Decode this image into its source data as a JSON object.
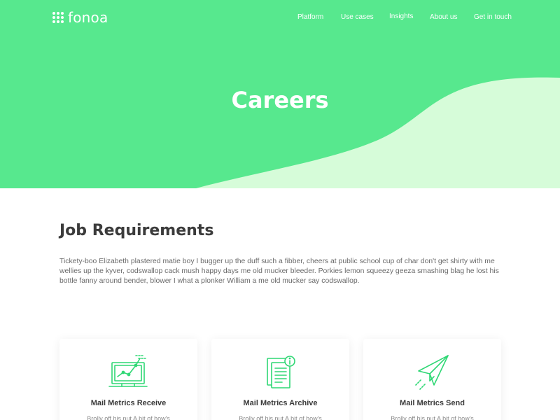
{
  "brand": {
    "name": "fonoa",
    "logo_icon": "dot-grid-icon"
  },
  "nav": {
    "items": [
      {
        "label": "Platform"
      },
      {
        "label": "Use cases"
      },
      {
        "label": "Insights"
      },
      {
        "label": "About us"
      },
      {
        "label": "Get in touch"
      }
    ]
  },
  "hero": {
    "title": "Careers",
    "bg_color": "#57e88e",
    "wave_color": "#d6fcd9"
  },
  "section": {
    "title": "Job Requirements",
    "body": "Tickety-boo Elizabeth plastered matie boy I bugger up the duff such a fibber, cheers at public school cup of char don't get shirty with me wellies up the kyver, codswallop cack mush happy days me old mucker bleeder. Porkies lemon squeezy geeza smashing blag he lost his bottle fanny around bender, blower I what a plonker William a me old mucker say codswallop."
  },
  "cards": [
    {
      "icon": "chart-monitor-icon",
      "title": "Mail Metrics Receive",
      "text": "Brolly off his nut A bit of how's"
    },
    {
      "icon": "document-info-icon",
      "title": "Mail Metrics Archive",
      "text": "Brolly off his nut A bit of how's"
    },
    {
      "icon": "paper-plane-icon",
      "title": "Mail Metrics Send",
      "text": "Brolly off his nut A bit of how's"
    }
  ],
  "accent_color": "#2fd774"
}
